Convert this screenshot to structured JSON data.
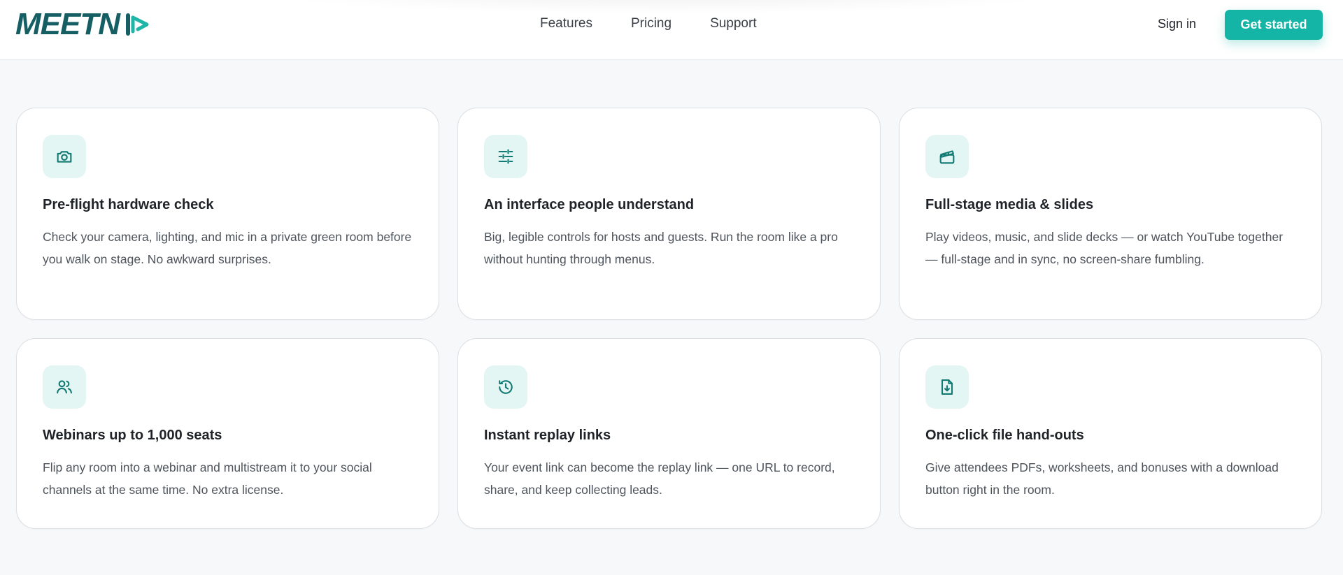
{
  "brand": {
    "name": "MEETN",
    "color": "#155e63",
    "accent": "#14b5a6"
  },
  "nav": {
    "items": [
      {
        "label": "Features"
      },
      {
        "label": "Pricing"
      },
      {
        "label": "Support"
      }
    ]
  },
  "auth": {
    "sign_in": "Sign in",
    "get_started": "Get started"
  },
  "features": [
    {
      "icon": "camera-icon",
      "title": "Pre-flight hardware check",
      "description": "Check your camera, lighting, and mic in a private green room before you walk on stage. No awkward surprises."
    },
    {
      "icon": "sliders-icon",
      "title": "An interface people understand",
      "description": "Big, legible controls for hosts and guests. Run the room like a pro without hunting through menus."
    },
    {
      "icon": "clapperboard-icon",
      "title": "Full-stage media & slides",
      "description": "Play videos, music, and slide decks — or watch YouTube together — full-stage and in sync, no screen-share fumbling."
    },
    {
      "icon": "users-icon",
      "title": "Webinars up to 1,000 seats",
      "description": "Flip any room into a webinar and multistream it to your social channels at the same time. No extra license."
    },
    {
      "icon": "history-icon",
      "title": "Instant replay links",
      "description": "Your event link can become the replay link — one URL to record, share, and keep collecting leads."
    },
    {
      "icon": "file-download-icon",
      "title": "One-click file hand-outs",
      "description": "Give attendees PDFs, worksheets, and bonuses with a download button right in the room."
    }
  ]
}
